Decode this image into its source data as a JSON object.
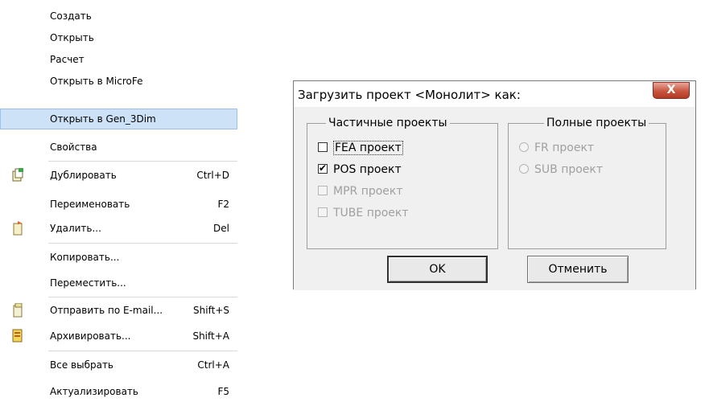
{
  "menu": {
    "items": [
      {
        "label": "Создать",
        "shortcut": ""
      },
      {
        "label": "Открыть",
        "shortcut": ""
      },
      {
        "label": "Расчет",
        "shortcut": ""
      },
      {
        "label": "Открыть в MicroFe",
        "shortcut": ""
      },
      {
        "label": "Открыть в Gen_3Dim",
        "shortcut": ""
      },
      {
        "label": "Свойства",
        "shortcut": ""
      },
      {
        "label": "Дублировать",
        "shortcut": "Ctrl+D"
      },
      {
        "label": "Переименовать",
        "shortcut": "F2"
      },
      {
        "label": "Удалить...",
        "shortcut": "Del"
      },
      {
        "label": "Копировать...",
        "shortcut": ""
      },
      {
        "label": "Переместить...",
        "shortcut": ""
      },
      {
        "label": "Отправить по E-mail...",
        "shortcut": "Shift+S"
      },
      {
        "label": "Архивировать...",
        "shortcut": "Shift+A"
      },
      {
        "label": "Все выбрать",
        "shortcut": "Ctrl+A"
      },
      {
        "label": "Актуализировать",
        "shortcut": "F5"
      }
    ],
    "highlighted": "Открыть в Gen_3Dim"
  },
  "dialog": {
    "title": "Загрузить проект  <Монолит> как:",
    "close_label": "X",
    "partial": {
      "legend": "Частичные проекты",
      "options": [
        {
          "label": "FEA проект",
          "checked": false,
          "enabled": true
        },
        {
          "label": "POS проект",
          "checked": true,
          "enabled": true
        },
        {
          "label": "MPR проект",
          "checked": false,
          "enabled": false
        },
        {
          "label": "TUBE проект",
          "checked": false,
          "enabled": false
        }
      ]
    },
    "full": {
      "legend": "Полные проекты",
      "options": [
        {
          "label": "FR проект",
          "enabled": false
        },
        {
          "label": "SUB проект",
          "enabled": false
        }
      ]
    },
    "ok_label": "OK",
    "cancel_label": "Отменить"
  },
  "icons": [
    "duplicate-icon",
    "delete-icon",
    "send-email-icon",
    "archive-icon"
  ]
}
